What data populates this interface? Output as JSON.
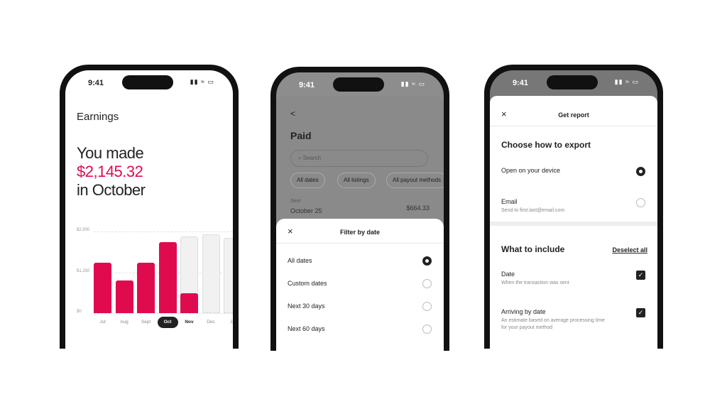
{
  "colors": {
    "accent": "#e00b4f",
    "projected": "#f1f1f1"
  },
  "phone1": {
    "time": "9:41",
    "title": "Earnings",
    "headline_1": "You made",
    "amount": "$2,145.32",
    "headline_3": "in October"
  },
  "chart_data": {
    "type": "bar",
    "categories": [
      "Jul",
      "Aug",
      "Sept",
      "Oct",
      "Nov",
      "Dec",
      "Ja"
    ],
    "values": [
      1545,
      1000,
      1545,
      2170,
      610,
      0,
      null
    ],
    "projected": [
      null,
      null,
      null,
      null,
      2350,
      2410,
      2300
    ],
    "selected": "Oct",
    "yticks": [
      "$0",
      "$1,250",
      "$2,500"
    ],
    "ylim": [
      0,
      2500
    ],
    "grid": true
  },
  "phone2": {
    "time": "9:41",
    "back": "<",
    "title": "Paid",
    "search_placeholder": "Search",
    "chips": [
      "All dates",
      "All listings",
      "All payout methods"
    ],
    "row_label": "Sent",
    "row_date": "October 25",
    "row_amount": "$664.33",
    "sheet": {
      "close": "×",
      "title": "Filter by date",
      "options": [
        {
          "label": "All dates",
          "selected": true
        },
        {
          "label": "Custom dates",
          "selected": false
        },
        {
          "label": "Next 30 days",
          "selected": false
        },
        {
          "label": "Next 60 days",
          "selected": false
        }
      ]
    }
  },
  "phone3": {
    "time": "9:41",
    "close": "×",
    "title": "Get report",
    "export_heading": "Choose how to export",
    "export_options": [
      {
        "label": "Open on your device",
        "sub": "",
        "selected": true
      },
      {
        "label": "Email",
        "sub": "Send to first.last@email.com",
        "selected": false
      }
    ],
    "include_heading": "What to include",
    "deselect": "Deselect all",
    "include_options": [
      {
        "label": "Date",
        "sub": "When the transaction was sent",
        "sub2": ""
      },
      {
        "label": "Arriving by date",
        "sub": "An estimate based on average processing time",
        "sub2": "for your payout method"
      }
    ]
  }
}
